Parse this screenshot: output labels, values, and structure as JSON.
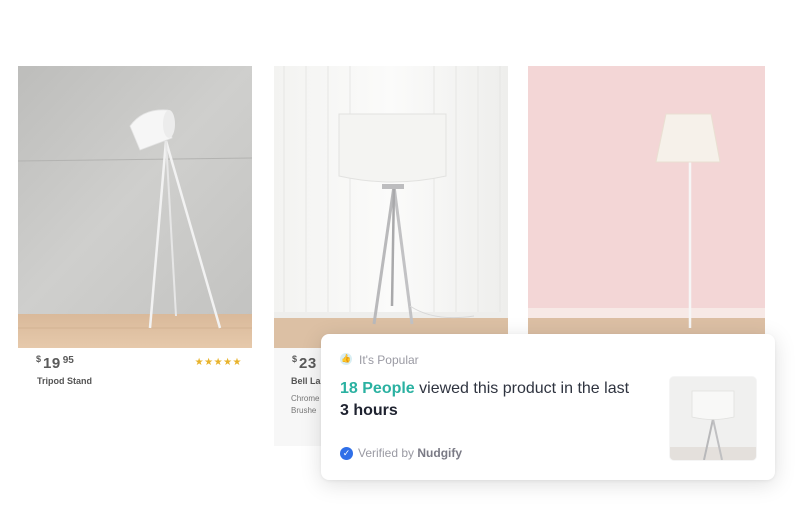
{
  "products": [
    {
      "price_currency": "$",
      "price_main": "19",
      "price_cents": "95",
      "name": "Tripod Stand",
      "stars": "★★★★★"
    },
    {
      "price_currency": "$",
      "price_main": "23",
      "name": "Bell La",
      "desc_line1": "Chrome",
      "desc_line2": "Brushe"
    }
  ],
  "popup": {
    "badge": "It's Popular",
    "count_text": "18 People",
    "message_mid": " viewed this product in the last ",
    "time_text": "3 hours",
    "verified_prefix": "Verified by ",
    "verified_brand": "Nudgify",
    "icons": {
      "badge": "thumbs-up-icon",
      "verified": "check-circle-icon"
    }
  },
  "colors": {
    "accent": "#2ab1a1",
    "stars": "#e8b32c",
    "verified": "#2f6fe8"
  }
}
